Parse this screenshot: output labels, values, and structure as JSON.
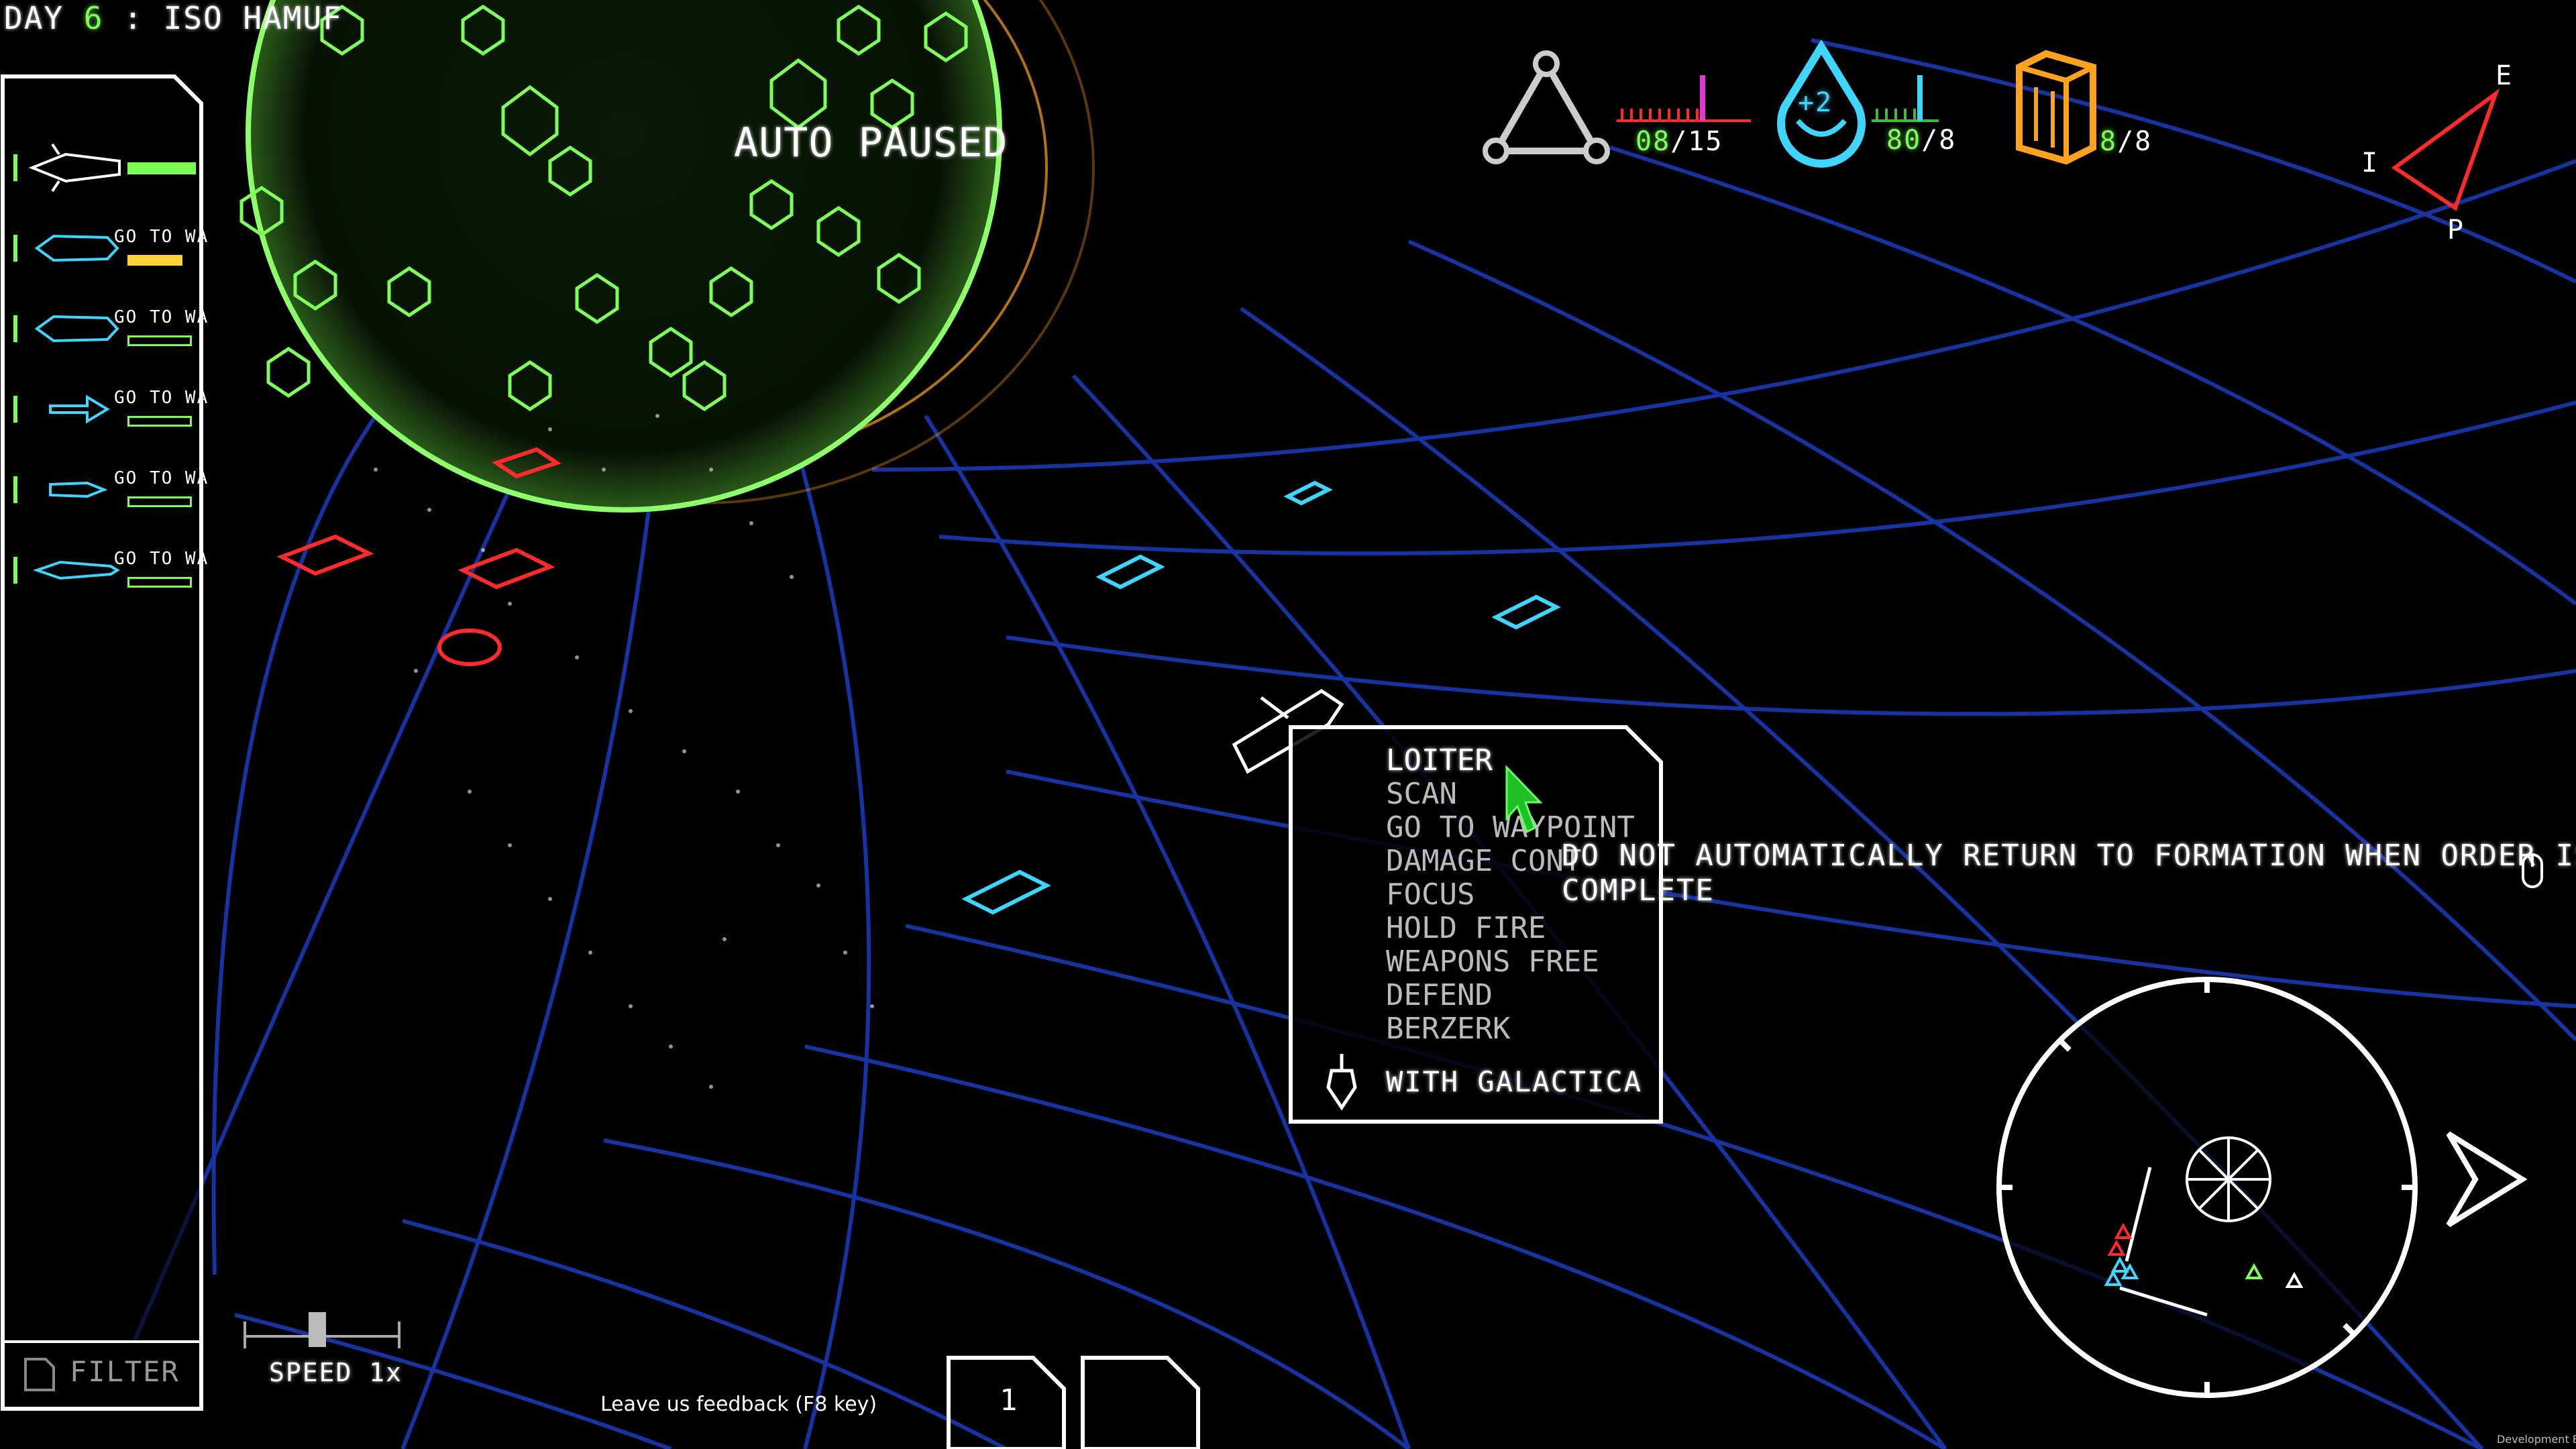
{
  "hud": {
    "day_label": "DAY",
    "day_value": "6",
    "location": ": ISO HAMUF",
    "auto_paused": "AUTO PAUSED"
  },
  "resources": {
    "crew": {
      "current": "08",
      "max": "/15",
      "icon": "triangle-nodes-icon",
      "color": "#ffffff"
    },
    "water": {
      "current": "80",
      "max": "/8",
      "badge": "+2",
      "icon": "water-drop-icon",
      "color": "#3ed6ff"
    },
    "fuel": {
      "current": "8",
      "max": "/8",
      "icon": "fuel-cell-icon",
      "color": "#ffa31a"
    }
  },
  "compass": {
    "e": "E",
    "i": "I",
    "p": "P"
  },
  "fleet": {
    "ships": [
      {
        "type": "battlestar",
        "order": "",
        "color": "#ffffff"
      },
      {
        "type": "raptor",
        "order": "GO TO WA",
        "color": "#3ed6ff"
      },
      {
        "type": "raptor",
        "order": "GO TO WA",
        "color": "#3ed6ff"
      },
      {
        "type": "viper",
        "order": "GO TO WA",
        "color": "#3ed6ff"
      },
      {
        "type": "viper",
        "order": "GO TO WA",
        "color": "#3ed6ff"
      },
      {
        "type": "viper",
        "order": "GO TO WA",
        "color": "#3ed6ff"
      }
    ],
    "filter_label": "FILTER"
  },
  "speed": {
    "label": "SPEED 1x"
  },
  "feedback": "Leave us feedback (F8 key)",
  "order_menu": {
    "items": [
      "LOITER",
      "SCAN",
      "GO TO WAYPOINT",
      "DAMAGE CONT",
      "FOCUS",
      "HOLD FIRE",
      "WEAPONS FREE",
      "DEFEND",
      "BERZERK"
    ],
    "selected": "LOITER",
    "footer": "WITH GALACTICA"
  },
  "tooltip": {
    "line1": "DO NOT AUTOMATICALLY RETURN TO FORMATION WHEN ORDER IS",
    "line2": "COMPLETE"
  },
  "bottom_buttons": {
    "left": "1",
    "right": ""
  },
  "dev_build": "Development Build",
  "colors": {
    "green": "#7dff57",
    "cyan": "#3ed6ff",
    "orange": "#ffa31a",
    "red": "#ff2a2a",
    "grid": "#1c3cbf"
  }
}
